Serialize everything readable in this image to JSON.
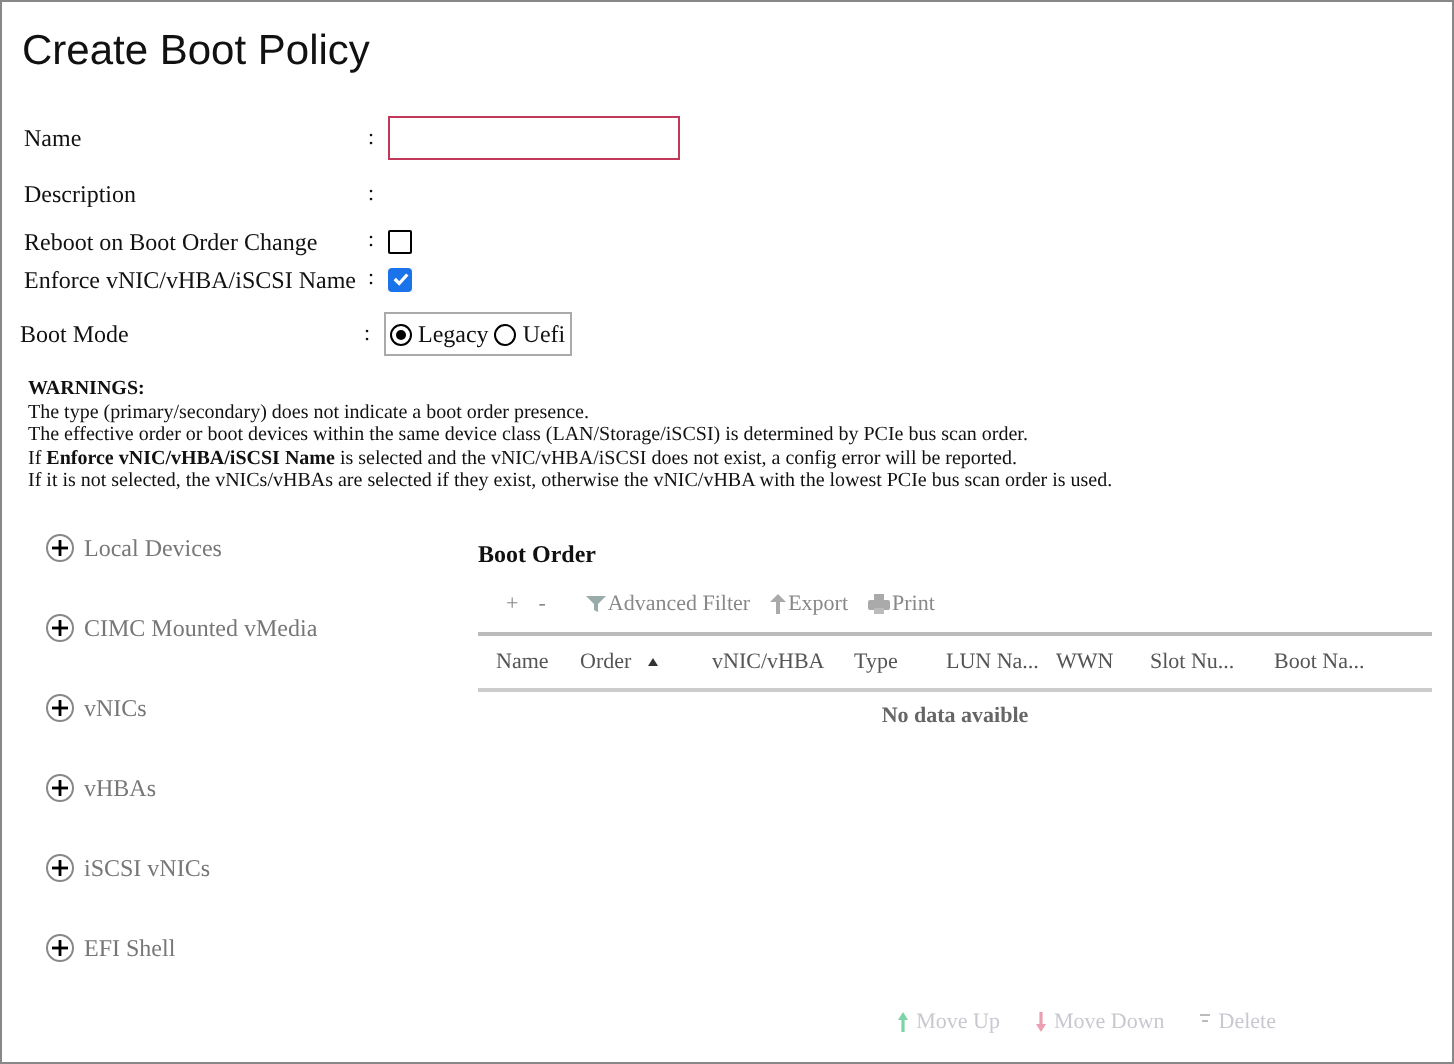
{
  "title": "Create Boot Policy",
  "fields": [
    {
      "label": "Name",
      "separator": ":",
      "kind": "text",
      "invalid": true
    },
    {
      "label": "Description",
      "separator": ":",
      "kind": "static"
    },
    {
      "label": "Reboot on Boot Order Change",
      "separator": ":",
      "kind": "checkbox",
      "checked": false
    },
    {
      "label": "Enforce vNIC/vHBA/iSCSI Name",
      "separator": ":",
      "kind": "checkbox",
      "checked": true
    },
    {
      "label": "Boot Mode",
      "separator": ":",
      "kind": "radio",
      "options": [
        {
          "label": "Legacy",
          "selected": true
        },
        {
          "label": "Uefi",
          "selected": false
        }
      ]
    }
  ],
  "warnings": {
    "heading": "WARNINGS:",
    "lines": [
      "The type (primary/secondary) does not indicate a boot order presence.",
      "The effective order or boot devices within the same device class (LAN/Storage/iSCSI) is determined by PCIe bus scan order.",
      "If **Enforce vNIC/vHBA/iSCSI Name** is selected and the vNIC/vHBA/iSCSI does not exist, a config error will be reported.",
      "If it is not selected, the vNICs/vHBAs are selected if they exist, otherwise the vNIC/vHBA with the lowest PCIe bus scan order is used."
    ]
  },
  "device_groups": [
    {
      "label": "Local Devices",
      "expanded": false
    },
    {
      "label": "CIMC Mounted vMedia",
      "expanded": false
    },
    {
      "label": "vNICs",
      "expanded": false
    },
    {
      "label": "vHBAs",
      "expanded": false
    },
    {
      "label": "iSCSI vNICs",
      "expanded": false
    },
    {
      "label": "EFI Shell",
      "expanded": false
    }
  ],
  "boot_order": {
    "title": "Boot Order",
    "toolbar": [
      {
        "kind": "add",
        "label": "+"
      },
      {
        "kind": "remove",
        "label": "-"
      },
      {
        "kind": "filter",
        "label": "Advanced Filter"
      },
      {
        "kind": "export",
        "label": "Export"
      },
      {
        "kind": "print",
        "label": "Print"
      }
    ],
    "columns": [
      {
        "label": "Name",
        "sorted": false
      },
      {
        "label": "Order",
        "sorted": true
      },
      {
        "label": "vNIC/vHBA",
        "sorted": false
      },
      {
        "label": "Type",
        "sorted": false
      },
      {
        "label": "LUN Na...",
        "sorted": false
      },
      {
        "label": "WWN",
        "sorted": false
      },
      {
        "label": "Slot Nu...",
        "sorted": false
      },
      {
        "label": "Boot Na...",
        "sorted": false
      }
    ],
    "empty_text": "No data avaible",
    "actions": [
      {
        "kind": "up",
        "label": "Move Up",
        "disabled": true
      },
      {
        "kind": "down",
        "label": "Move Down",
        "disabled": true
      },
      {
        "kind": "delete",
        "label": "Delete",
        "disabled": true
      }
    ]
  }
}
